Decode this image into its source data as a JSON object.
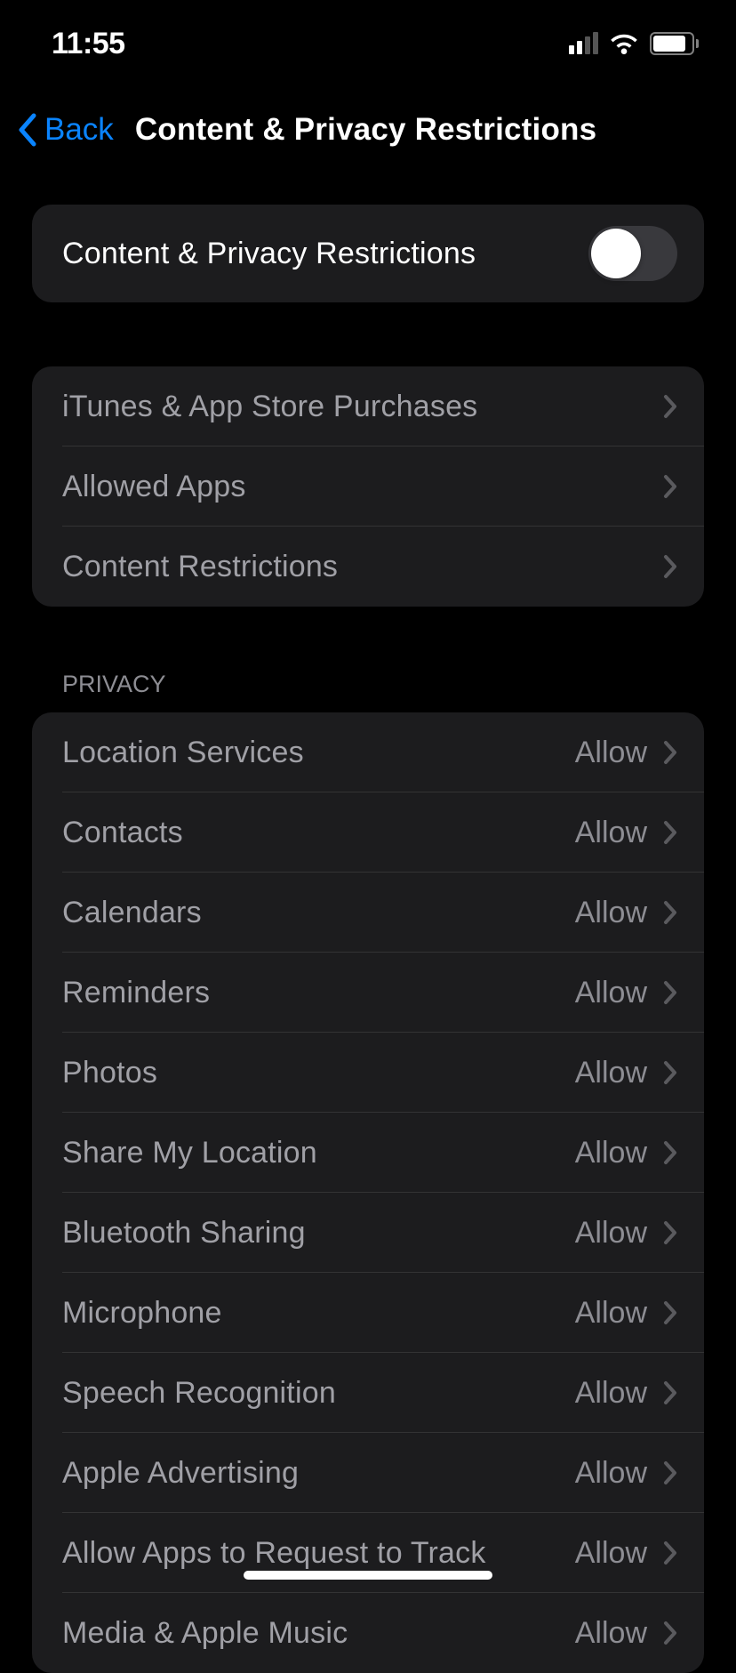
{
  "status_bar": {
    "time": "11:55"
  },
  "nav": {
    "back_label": "Back",
    "title": "Content & Privacy Restrictions"
  },
  "toggle": {
    "label": "Content & Privacy Restrictions",
    "on": false
  },
  "general_items": [
    {
      "label": "iTunes & App Store Purchases"
    },
    {
      "label": "Allowed Apps"
    },
    {
      "label": "Content Restrictions"
    }
  ],
  "privacy_header": "Privacy",
  "privacy_items": [
    {
      "label": "Location Services",
      "value": "Allow"
    },
    {
      "label": "Contacts",
      "value": "Allow"
    },
    {
      "label": "Calendars",
      "value": "Allow"
    },
    {
      "label": "Reminders",
      "value": "Allow"
    },
    {
      "label": "Photos",
      "value": "Allow"
    },
    {
      "label": "Share My Location",
      "value": "Allow"
    },
    {
      "label": "Bluetooth Sharing",
      "value": "Allow"
    },
    {
      "label": "Microphone",
      "value": "Allow"
    },
    {
      "label": "Speech Recognition",
      "value": "Allow"
    },
    {
      "label": "Apple Advertising",
      "value": "Allow"
    },
    {
      "label": "Allow Apps to Request to Track",
      "value": "Allow"
    },
    {
      "label": "Media & Apple Music",
      "value": "Allow"
    }
  ]
}
